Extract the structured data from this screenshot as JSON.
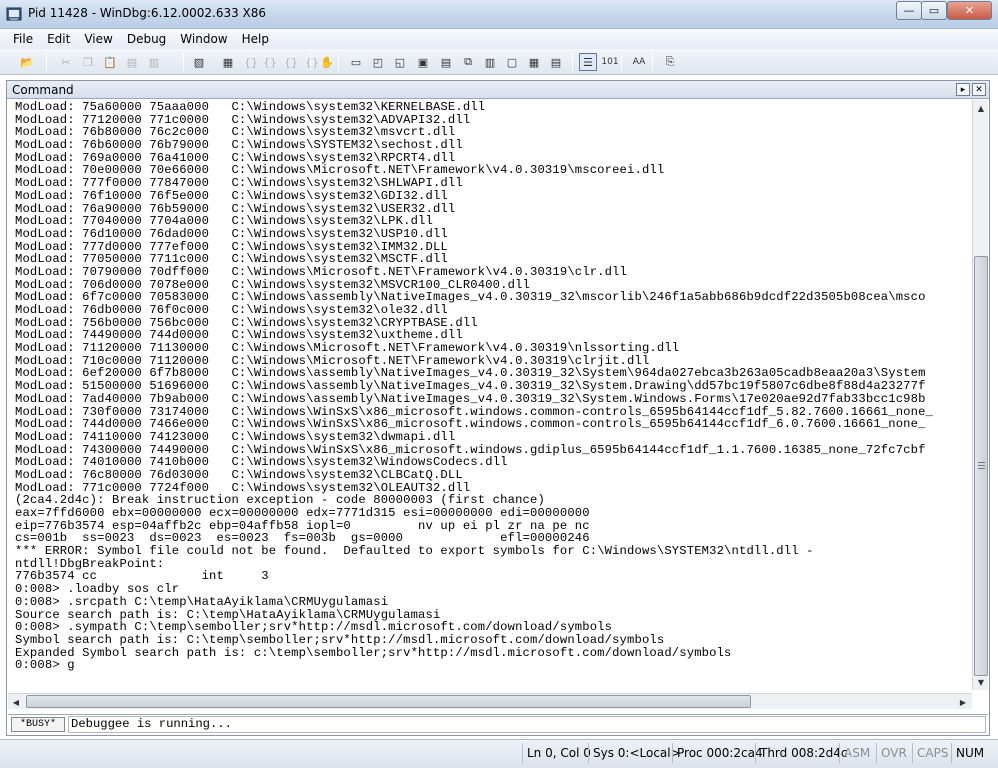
{
  "window": {
    "title": "Pid 11428 - WinDbg:6.12.0002.633 X86",
    "minimize_glyph": "—",
    "maximize_glyph": "▭",
    "close_glyph": "✕"
  },
  "menu": [
    "File",
    "Edit",
    "View",
    "Debug",
    "Window",
    "Help"
  ],
  "toolbar": {
    "buttons": [
      {
        "icon": "open-folder-icon",
        "glyph": "📂",
        "enabled": true
      },
      {
        "icon": "cut-icon",
        "glyph": "✂",
        "enabled": false
      },
      {
        "icon": "copy-icon",
        "glyph": "❐",
        "enabled": false
      },
      {
        "icon": "paste-icon",
        "glyph": "📋",
        "enabled": false
      },
      {
        "icon": "go-icon",
        "glyph": "▤",
        "enabled": false
      },
      {
        "icon": "restart-icon",
        "glyph": "▥",
        "enabled": false
      },
      {
        "icon": "stop-debugging-icon",
        "glyph": "▧",
        "enabled": true
      },
      {
        "icon": "break-icon",
        "glyph": "▦",
        "enabled": true
      },
      {
        "icon": "step-into-icon",
        "glyph": "{}",
        "enabled": false
      },
      {
        "icon": "step-over-icon",
        "glyph": "{}",
        "enabled": false
      },
      {
        "icon": "step-out-icon",
        "glyph": "{}",
        "enabled": false
      },
      {
        "icon": "run-to-cursor-icon",
        "glyph": "{}",
        "enabled": false
      },
      {
        "icon": "breakpoint-hand-icon",
        "glyph": "✋",
        "enabled": true
      },
      {
        "icon": "command-window-icon",
        "glyph": "▭",
        "enabled": true
      },
      {
        "icon": "watch-window-icon",
        "glyph": "◰",
        "enabled": true
      },
      {
        "icon": "locals-window-icon",
        "glyph": "◱",
        "enabled": true
      },
      {
        "icon": "registers-window-icon",
        "glyph": "▣",
        "enabled": true
      },
      {
        "icon": "memory-window-icon",
        "glyph": "▤",
        "enabled": true
      },
      {
        "icon": "call-stack-window-icon",
        "glyph": "⧉",
        "enabled": true
      },
      {
        "icon": "disassembly-window-icon",
        "glyph": "▥",
        "enabled": true
      },
      {
        "icon": "scratch-pad-icon",
        "glyph": "▢",
        "enabled": true
      },
      {
        "icon": "processes-threads-icon",
        "glyph": "▦",
        "enabled": true
      },
      {
        "icon": "source-mode-icon",
        "glyph": "▤",
        "enabled": true
      },
      {
        "icon": "source-mode-on-icon",
        "glyph": "☰",
        "enabled": true,
        "pressed": true
      },
      {
        "icon": "hex-display-icon",
        "glyph": "101",
        "enabled": true
      },
      {
        "icon": "font-icon",
        "glyph": "AA",
        "enabled": true
      },
      {
        "icon": "options-icon",
        "glyph": "⎘",
        "enabled": true
      }
    ]
  },
  "command_window": {
    "title": "Command",
    "output_lines": [
      "ModLoad: 75a60000 75aaa000   C:\\Windows\\system32\\KERNELBASE.dll",
      "ModLoad: 77120000 771c0000   C:\\Windows\\system32\\ADVAPI32.dll",
      "ModLoad: 76b80000 76c2c000   C:\\Windows\\system32\\msvcrt.dll",
      "ModLoad: 76b60000 76b79000   C:\\Windows\\SYSTEM32\\sechost.dll",
      "ModLoad: 769a0000 76a41000   C:\\Windows\\system32\\RPCRT4.dll",
      "ModLoad: 70e00000 70e66000   C:\\Windows\\Microsoft.NET\\Framework\\v4.0.30319\\mscoreei.dll",
      "ModLoad: 777f0000 77847000   C:\\Windows\\system32\\SHLWAPI.dll",
      "ModLoad: 76f10000 76f5e000   C:\\Windows\\system32\\GDI32.dll",
      "ModLoad: 76a90000 76b59000   C:\\Windows\\system32\\USER32.dll",
      "ModLoad: 77040000 7704a000   C:\\Windows\\system32\\LPK.dll",
      "ModLoad: 76d10000 76dad000   C:\\Windows\\system32\\USP10.dll",
      "ModLoad: 777d0000 777ef000   C:\\Windows\\system32\\IMM32.DLL",
      "ModLoad: 77050000 7711c000   C:\\Windows\\system32\\MSCTF.dll",
      "ModLoad: 70790000 70dff000   C:\\Windows\\Microsoft.NET\\Framework\\v4.0.30319\\clr.dll",
      "ModLoad: 706d0000 7078e000   C:\\Windows\\system32\\MSVCR100_CLR0400.dll",
      "ModLoad: 6f7c0000 70583000   C:\\Windows\\assembly\\NativeImages_v4.0.30319_32\\mscorlib\\246f1a5abb686b9dcdf22d3505b08cea\\msco",
      "ModLoad: 76db0000 76f0c000   C:\\Windows\\system32\\ole32.dll",
      "ModLoad: 756b0000 756bc000   C:\\Windows\\system32\\CRYPTBASE.dll",
      "ModLoad: 74490000 744d0000   C:\\Windows\\system32\\uxtheme.dll",
      "ModLoad: 71120000 71130000   C:\\Windows\\Microsoft.NET\\Framework\\v4.0.30319\\nlssorting.dll",
      "ModLoad: 710c0000 71120000   C:\\Windows\\Microsoft.NET\\Framework\\v4.0.30319\\clrjit.dll",
      "ModLoad: 6ef20000 6f7b8000   C:\\Windows\\assembly\\NativeImages_v4.0.30319_32\\System\\964da027ebca3b263a05cadb8eaa20a3\\System",
      "ModLoad: 51500000 51696000   C:\\Windows\\assembly\\NativeImages_v4.0.30319_32\\System.Drawing\\dd57bc19f5807c6dbe8f88d4a23277f",
      "ModLoad: 7ad40000 7b9ab000   C:\\Windows\\assembly\\NativeImages_v4.0.30319_32\\System.Windows.Forms\\17e020ae92d7fab33bcc1c98b",
      "ModLoad: 730f0000 73174000   C:\\Windows\\WinSxS\\x86_microsoft.windows.common-controls_6595b64144ccf1df_5.82.7600.16661_none_",
      "ModLoad: 744d0000 7466e000   C:\\Windows\\WinSxS\\x86_microsoft.windows.common-controls_6595b64144ccf1df_6.0.7600.16661_none_",
      "ModLoad: 74110000 74123000   C:\\Windows\\system32\\dwmapi.dll",
      "ModLoad: 74300000 74490000   C:\\Windows\\WinSxS\\x86_microsoft.windows.gdiplus_6595b64144ccf1df_1.1.7600.16385_none_72fc7cbf",
      "ModLoad: 74010000 7410b000   C:\\Windows\\system32\\WindowsCodecs.dll",
      "ModLoad: 76c80000 76d03000   C:\\Windows\\system32\\CLBCatQ.DLL",
      "ModLoad: 771c0000 7724f000   C:\\Windows\\system32\\OLEAUT32.dll",
      "(2ca4.2d4c): Break instruction exception - code 80000003 (first chance)",
      "eax=7ffd6000 ebx=00000000 ecx=00000000 edx=7771d315 esi=00000000 edi=00000000",
      "eip=776b3574 esp=04affb2c ebp=04affb58 iopl=0         nv up ei pl zr na pe nc",
      "cs=001b  ss=0023  ds=0023  es=0023  fs=003b  gs=0000             efl=00000246",
      "*** ERROR: Symbol file could not be found.  Defaulted to export symbols for C:\\Windows\\SYSTEM32\\ntdll.dll -",
      "ntdll!DbgBreakPoint:",
      "776b3574 cc              int     3",
      "0:008> .loadby sos clr",
      "0:008> .srcpath C:\\temp\\HataAyiklama\\CRMUygulamasi",
      "Source search path is: C:\\temp\\HataAyiklama\\CRMUygulamasi",
      "0:008> .sympath C:\\temp\\semboller;srv*http://msdl.microsoft.com/download/symbols",
      "Symbol search path is: C:\\temp\\semboller;srv*http://msdl.microsoft.com/download/symbols",
      "Expanded Symbol search path is: c:\\temp\\semboller;srv*http://msdl.microsoft.com/download/symbols",
      "0:008> g"
    ],
    "busy_label": "*BUSY*",
    "input_text": "Debuggee is running..."
  },
  "statusbar": {
    "line_col": "Ln 0, Col 0",
    "sys": "Sys 0:<Local>",
    "proc": "Proc 000:2ca4",
    "thrd": "Thrd 008:2d4c",
    "asm": "ASM",
    "ovr": "OVR",
    "caps": "CAPS",
    "num": "NUM"
  }
}
